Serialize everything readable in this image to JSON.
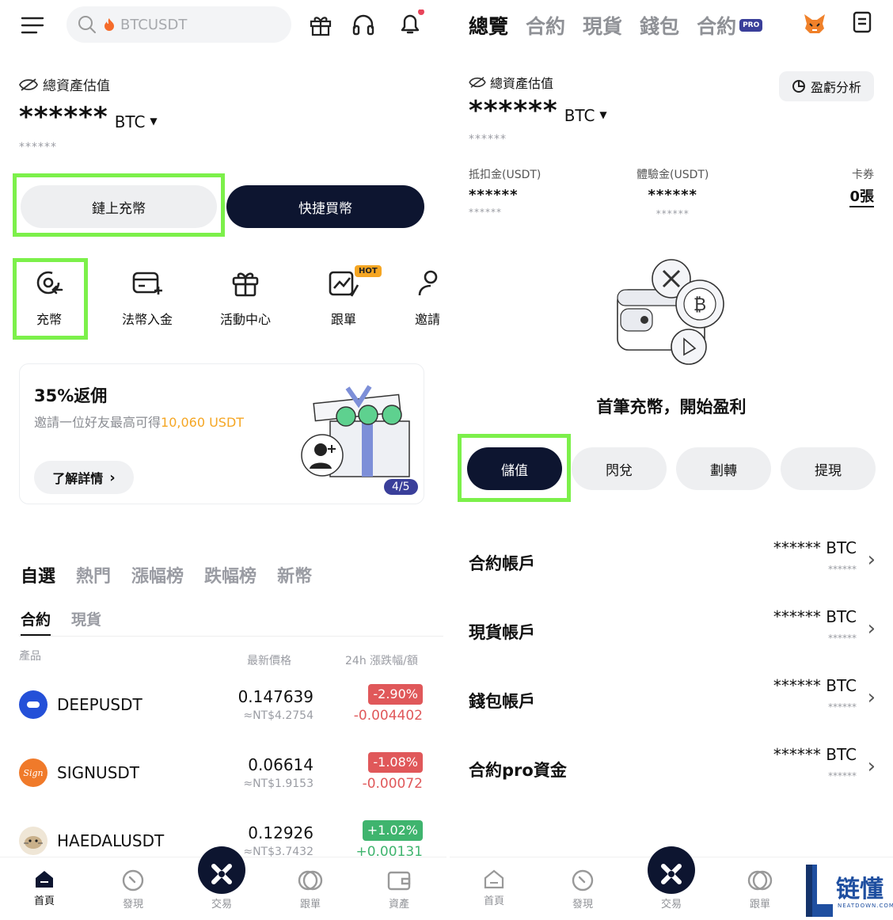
{
  "left": {
    "search": {
      "placeholder": "BTCUSDT"
    },
    "asset": {
      "label": "總資產估值",
      "value": "******",
      "unit": "BTC",
      "sub": "******"
    },
    "buttons": {
      "onchain": "鏈上充幣",
      "quickbuy": "快捷買幣"
    },
    "shortcuts": [
      {
        "label": "充幣",
        "icon": "deposit-icon"
      },
      {
        "label": "法幣入金",
        "icon": "fiat-card-icon"
      },
      {
        "label": "活動中心",
        "icon": "gift-icon"
      },
      {
        "label": "跟單",
        "icon": "copy-trade-icon",
        "badge": "HOT"
      },
      {
        "label": "邀請",
        "icon": "invite-icon"
      }
    ],
    "promo": {
      "title": "35%返佣",
      "desc": "邀請一位好友最高可得",
      "amount": "10,060 USDT",
      "button": "了解詳情",
      "pager": "4/5"
    },
    "market_tabs": [
      "自選",
      "熱門",
      "漲幅榜",
      "跌幅榜",
      "新幣"
    ],
    "sub_tabs": [
      "合約",
      "現貨"
    ],
    "table": {
      "headers": {
        "product": "產品",
        "price": "最新價格",
        "change": "24h 漲跌幅/額"
      },
      "rows": [
        {
          "symbol": "DEEPUSDT",
          "price": "0.147639",
          "fiat": "≈NT$4.2754",
          "pct": "-2.90%",
          "amt": "-0.004402",
          "up": false,
          "logo_color": "#2450d8"
        },
        {
          "symbol": "SIGNUSDT",
          "price": "0.06614",
          "fiat": "≈NT$1.9153",
          "pct": "-1.08%",
          "amt": "-0.00072",
          "up": false,
          "logo_color": "#f07a2a"
        },
        {
          "symbol": "HAEDALUSDT",
          "price": "0.12926",
          "fiat": "≈NT$3.7432",
          "pct": "+1.02%",
          "amt": "+0.00131",
          "up": true,
          "logo_color": "#efe6d6"
        }
      ]
    },
    "tabbar": [
      "首頁",
      "發現",
      "交易",
      "跟單",
      "資產"
    ]
  },
  "right": {
    "top_tabs": [
      "總覽",
      "合約",
      "現貨",
      "錢包",
      "合約"
    ],
    "pro_badge": "PRO",
    "asset": {
      "label": "總資產估值",
      "value": "******",
      "unit": "BTC",
      "sub": "******",
      "pnl_button": "盈虧分析"
    },
    "metrics": [
      {
        "label": "抵扣金(USDT)",
        "value": "******",
        "sub": "******"
      },
      {
        "label": "體驗金(USDT)",
        "value": "******",
        "sub": "******"
      },
      {
        "label": "卡券",
        "value": "0張"
      }
    ],
    "cta": "首筆充幣，開始盈利",
    "actions": [
      "儲值",
      "閃兌",
      "劃轉",
      "提現"
    ],
    "accounts": [
      {
        "name": "合約帳戶",
        "value": "****** BTC",
        "sub": "******"
      },
      {
        "name": "現貨帳戶",
        "value": "****** BTC",
        "sub": "******"
      },
      {
        "name": "錢包帳戶",
        "value": "****** BTC",
        "sub": "******"
      },
      {
        "name": "合約pro資金",
        "value": "****** BTC",
        "sub": "******"
      }
    ],
    "tabbar": [
      "首頁",
      "發現",
      "交易",
      "跟單"
    ]
  },
  "watermark": {
    "title": "链懂",
    "url": "NEATDOWN.COM"
  },
  "colors": {
    "navy": "#0d1530",
    "red": "#e0585a",
    "green": "#3fb46e",
    "orange": "#f5a623",
    "highlight": "#7cf04a",
    "purple_badge": "#3a3f9a"
  }
}
